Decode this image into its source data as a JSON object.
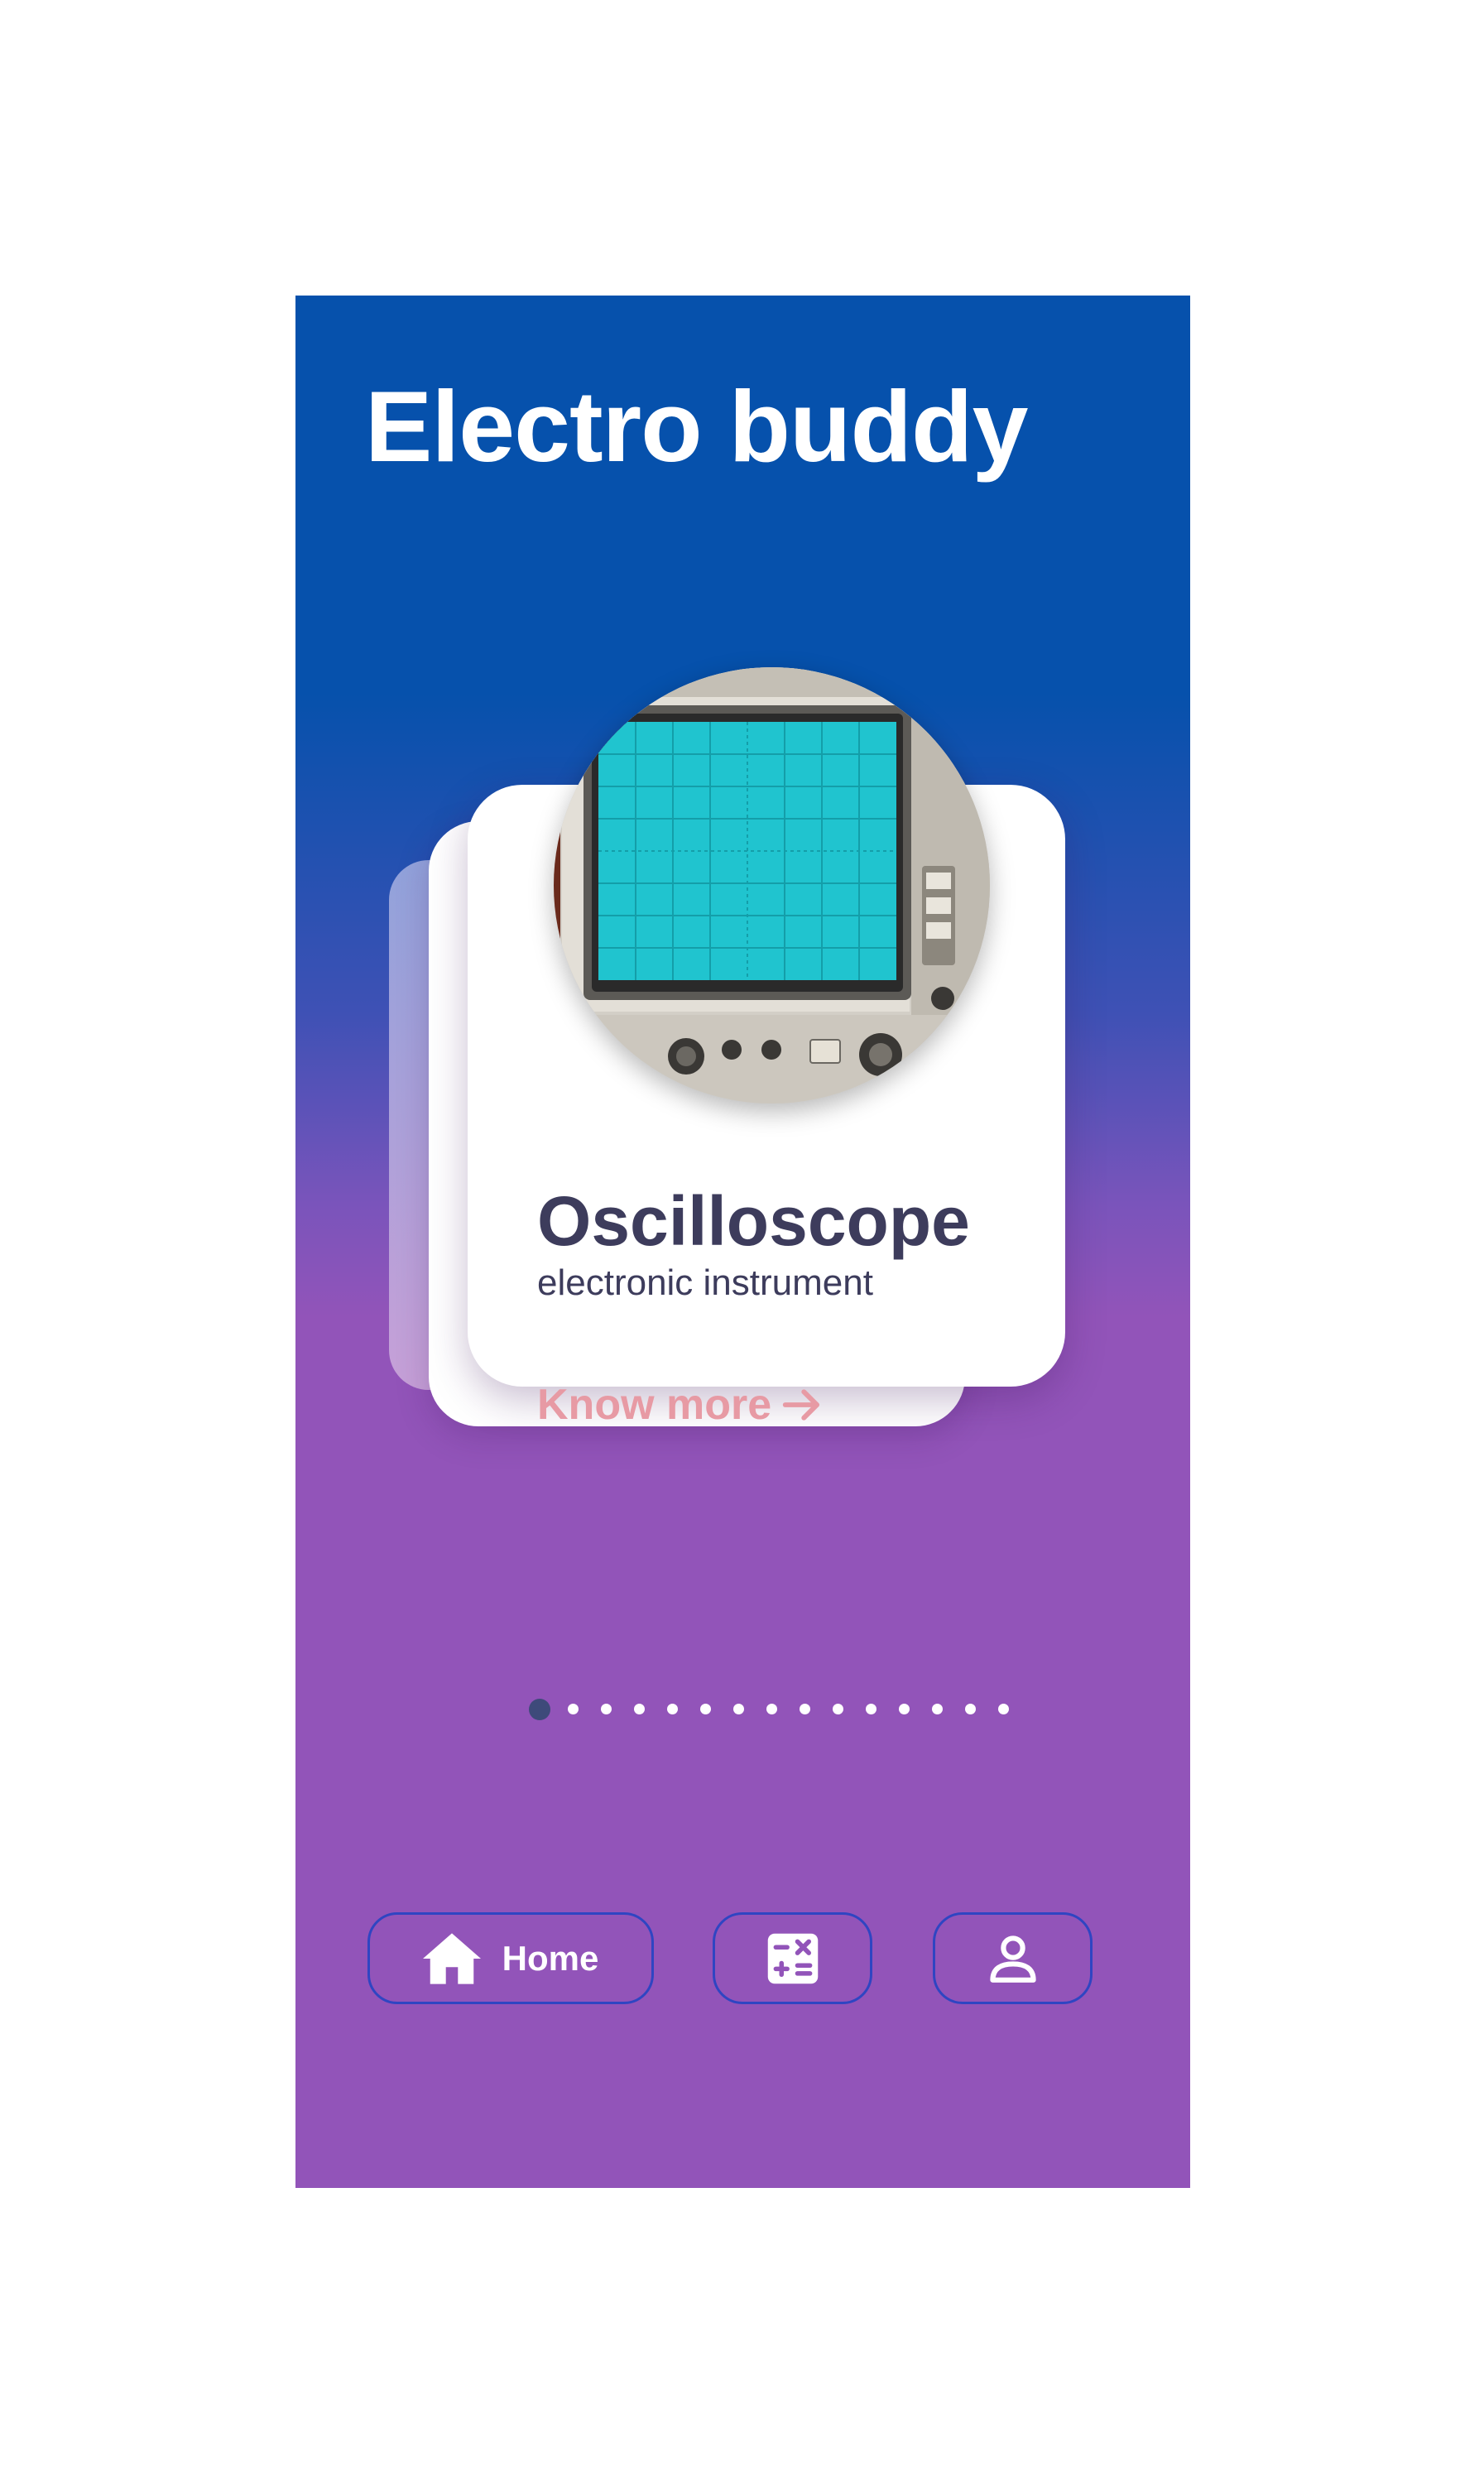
{
  "app": {
    "title": "Electro buddy"
  },
  "card": {
    "name": "Oscilloscope",
    "subtitle": "electronic instrument",
    "cta_label": "Know more",
    "image_icon": "oscilloscope-photo"
  },
  "pagination": {
    "total": 15,
    "active_index": 0
  },
  "nav": {
    "home_label": "Home",
    "home_icon": "house-icon",
    "calculator_icon": "calculator-icon",
    "profile_icon": "person-icon"
  },
  "colors": {
    "gradient_top": "#0651ac",
    "gradient_bottom": "#9254b9",
    "title_text": "#3d3c5c",
    "cta_text": "#e79aa4",
    "nav_border": "#2f45c2",
    "active_dot": "#3e4a7a"
  }
}
